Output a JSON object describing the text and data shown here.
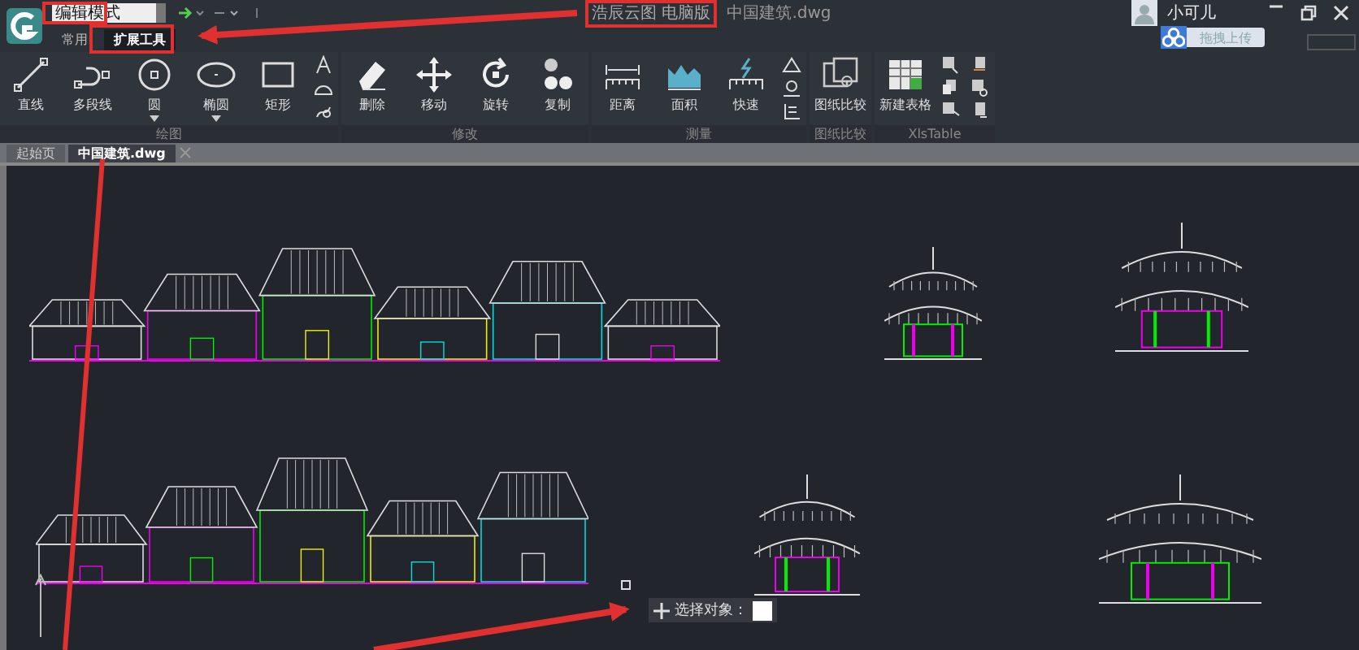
{
  "title_bar": {
    "mode_dropdown": {
      "value": "编辑模式"
    },
    "app_title": "浩辰云图 电脑版",
    "document_title": "中国建筑.dwg",
    "user_name": "小可儿",
    "upload_button": "拖拽上传"
  },
  "ribbon_tabs": [
    {
      "label": "常用",
      "selected": false
    },
    {
      "label": "扩展工具",
      "selected": true
    }
  ],
  "ribbon_groups": [
    {
      "label": "绘图",
      "tools": [
        {
          "kind": "large",
          "label": "直线",
          "dropdown": false
        },
        {
          "kind": "large",
          "label": "多段线",
          "dropdown": false
        },
        {
          "kind": "large",
          "label": "圆",
          "dropdown": true
        },
        {
          "kind": "large",
          "label": "椭圆",
          "dropdown": true
        },
        {
          "kind": "large",
          "label": "矩形",
          "dropdown": false
        },
        {
          "kind": "small"
        },
        {
          "kind": "small"
        },
        {
          "kind": "small"
        }
      ]
    },
    {
      "label": "修改",
      "tools": [
        {
          "kind": "large",
          "label": "删除",
          "dropdown": false
        },
        {
          "kind": "large",
          "label": "移动",
          "dropdown": false
        },
        {
          "kind": "large",
          "label": "旋转",
          "dropdown": false
        },
        {
          "kind": "large",
          "label": "复制",
          "dropdown": false
        }
      ]
    },
    {
      "label": "测量",
      "tools": [
        {
          "kind": "large",
          "label": "距离",
          "dropdown": false
        },
        {
          "kind": "large",
          "label": "面积",
          "dropdown": false
        },
        {
          "kind": "large",
          "label": "快速",
          "dropdown": false
        },
        {
          "kind": "small"
        },
        {
          "kind": "small"
        },
        {
          "kind": "small"
        }
      ]
    },
    {
      "label": "图纸比较",
      "tools": [
        {
          "kind": "large",
          "label": "图纸比较",
          "dropdown": false
        }
      ]
    },
    {
      "label": "XlsTable",
      "tools": [
        {
          "kind": "large",
          "label": "新建表格",
          "dropdown": false
        },
        {
          "kind": "small"
        },
        {
          "kind": "small"
        },
        {
          "kind": "small"
        },
        {
          "kind": "small"
        },
        {
          "kind": "small"
        },
        {
          "kind": "small"
        }
      ]
    }
  ],
  "document_tabs": [
    {
      "label": "起始页",
      "selected": false
    },
    {
      "label": "中国建筑.dwg",
      "selected": true
    }
  ],
  "command_prompt": {
    "text": "选择对象："
  }
}
